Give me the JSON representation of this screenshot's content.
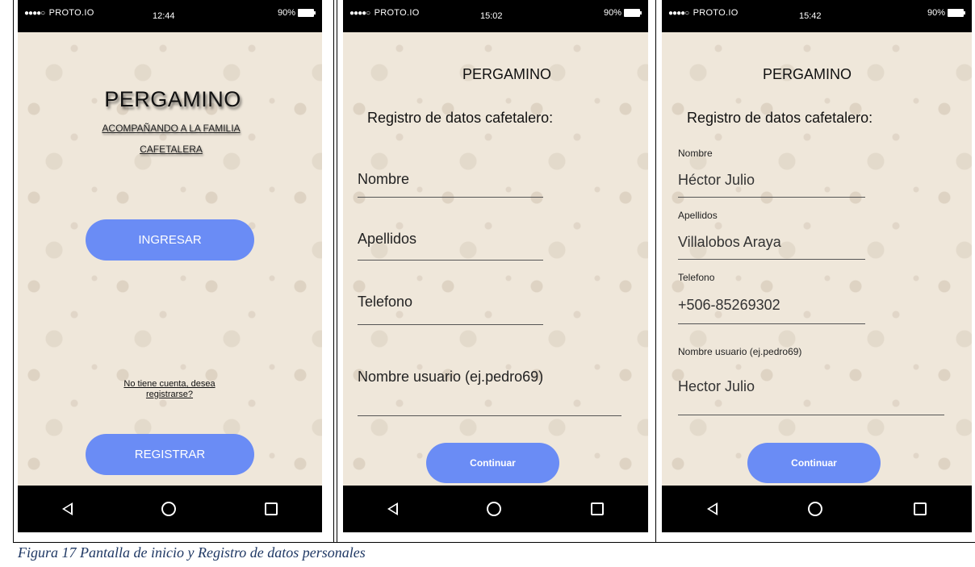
{
  "status": {
    "carrier": "PROTO.IO",
    "battery": "90%",
    "times": [
      "12:44",
      "15:02",
      "15:42"
    ]
  },
  "screen1": {
    "title": "PERGAMINO",
    "subtitle_line1": "ACOMPAÑANDO A LA FAMILIA",
    "subtitle_line2": "CAFETALERA",
    "ingresar": "INGRESAR",
    "register_link_line1": "No tiene cuenta, desea",
    "register_link_line2": "registrarse?",
    "registrar": "REGISTRAR"
  },
  "screen2": {
    "brand": "PERGAMINO",
    "heading": "Registro de datos cafetalero:",
    "fields": [
      "Nombre",
      "Apellidos",
      "Telefono",
      "Nombre usuario (ej.pedro69)"
    ],
    "button": "Continuar"
  },
  "screen3": {
    "brand": "PERGAMINO",
    "heading": "Registro de datos cafetalero:",
    "fields": [
      {
        "label": "Nombre",
        "value": "Héctor Julio"
      },
      {
        "label": "Apellidos",
        "value": "Villalobos Araya"
      },
      {
        "label": "Telefono",
        "value": "+506-85269302"
      },
      {
        "label": "Nombre usuario (ej.pedro69)",
        "value": "Hector Julio"
      }
    ],
    "button": "Continuar"
  },
  "caption": "Figura 17 Pantalla de inicio y Registro de datos personales",
  "colors": {
    "button": "#6a8cf5",
    "background": "#efe7da",
    "caption": "#1f3864"
  }
}
